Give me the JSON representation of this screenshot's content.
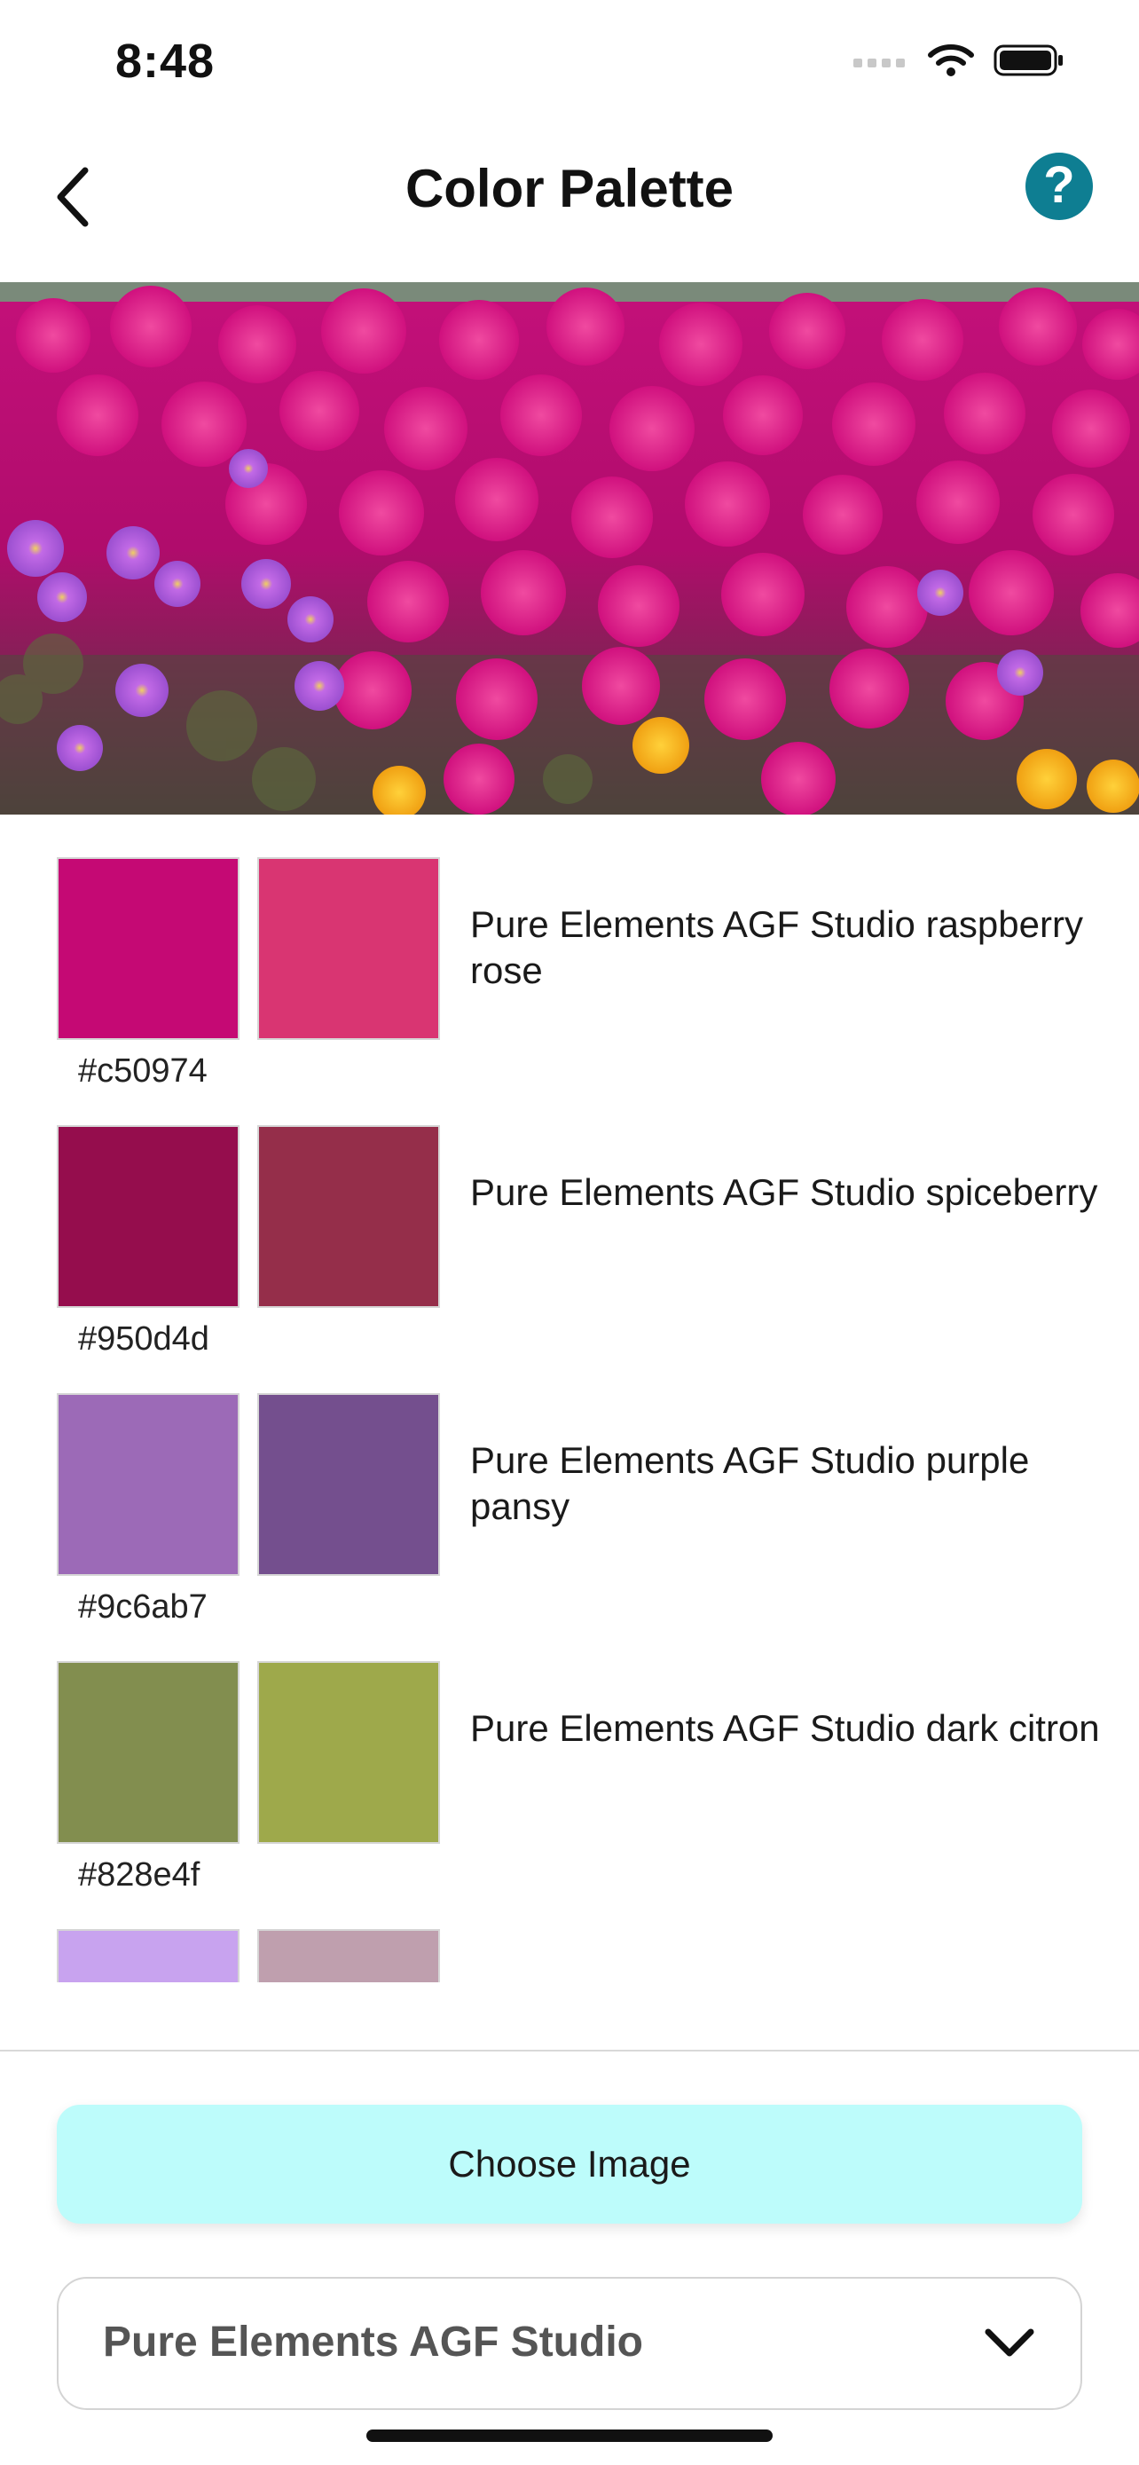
{
  "status_bar": {
    "time": "8:48"
  },
  "header": {
    "title": "Color Palette",
    "back_icon": "chevron-left-icon",
    "help_label": "?",
    "help_color": "#0e7e92"
  },
  "palette": [
    {
      "hex": "#c50974",
      "match_color": "#d93572",
      "name": "Pure Elements AGF Studio raspberry rose"
    },
    {
      "hex": "#950d4d",
      "match_color": "#952e4a",
      "name": "Pure Elements AGF Studio spiceberry"
    },
    {
      "hex": "#9c6ab7",
      "match_color": "#744f8e",
      "name": "Pure Elements AGF Studio purple pansy"
    },
    {
      "hex": "#828e4f",
      "match_color": "#9ea94b",
      "name": "Pure Elements AGF Studio dark citron"
    },
    {
      "hex": "#c8a3ef",
      "match_color": "#bf9fae",
      "name": ""
    }
  ],
  "footer": {
    "choose_image_label": "Choose Image",
    "choose_image_color": "#bdfcfb",
    "brand_select_value": "Pure Elements AGF Studio",
    "brand_select_icon": "chevron-down-icon"
  }
}
